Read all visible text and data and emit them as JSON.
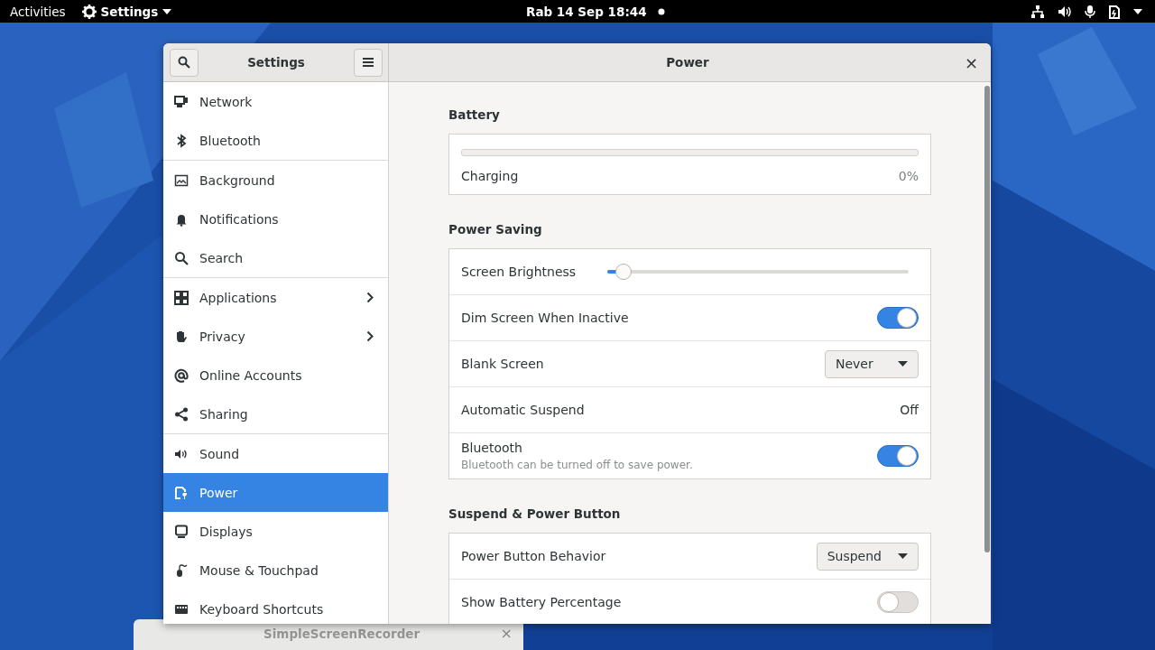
{
  "top_bar": {
    "activities": "Activities",
    "app_menu": "Settings",
    "clock": "Rab 14 Sep  18:44",
    "notification_dot": true
  },
  "background_window": {
    "title": "SimpleScreenRecorder",
    "close": "×"
  },
  "window": {
    "sidebar_title": "Settings",
    "title": "Power",
    "close": "×"
  },
  "sidebar": {
    "groups": [
      [
        {
          "label": "Network",
          "submenu": false,
          "selected": false
        },
        {
          "label": "Bluetooth",
          "submenu": false,
          "selected": false
        }
      ],
      [
        {
          "label": "Background",
          "submenu": false,
          "selected": false
        },
        {
          "label": "Notifications",
          "submenu": false,
          "selected": false
        },
        {
          "label": "Search",
          "submenu": false,
          "selected": false
        }
      ],
      [
        {
          "label": "Applications",
          "submenu": true,
          "selected": false
        },
        {
          "label": "Privacy",
          "submenu": true,
          "selected": false
        },
        {
          "label": "Online Accounts",
          "submenu": false,
          "selected": false
        },
        {
          "label": "Sharing",
          "submenu": false,
          "selected": false
        }
      ],
      [
        {
          "label": "Sound",
          "submenu": false,
          "selected": false
        },
        {
          "label": "Power",
          "submenu": false,
          "selected": true
        },
        {
          "label": "Displays",
          "submenu": false,
          "selected": false
        },
        {
          "label": "Mouse & Touchpad",
          "submenu": false,
          "selected": false
        },
        {
          "label": "Keyboard Shortcuts",
          "submenu": false,
          "selected": false
        }
      ]
    ]
  },
  "sections": [
    {
      "title": "Battery",
      "rows": [
        {
          "kind": "battery",
          "label": "Charging",
          "value": "0%",
          "level": 0
        }
      ]
    },
    {
      "title": "Power Saving",
      "rows": [
        {
          "kind": "slider",
          "label": "Screen Brightness",
          "level": 0.04
        },
        {
          "kind": "switch",
          "label": "Dim Screen When Inactive",
          "on": true
        },
        {
          "kind": "dropdown",
          "label": "Blank Screen",
          "value": "Never"
        },
        {
          "kind": "value",
          "label": "Automatic Suspend",
          "value": "Off"
        },
        {
          "kind": "switch",
          "label": "Bluetooth",
          "subtitle": "Bluetooth can be turned off to save power.",
          "on": true
        }
      ]
    },
    {
      "title": "Suspend & Power Button",
      "rows": [
        {
          "kind": "dropdown",
          "label": "Power Button Behavior",
          "value": "Suspend"
        },
        {
          "kind": "switch",
          "label": "Show Battery Percentage",
          "on": false
        }
      ]
    }
  ]
}
